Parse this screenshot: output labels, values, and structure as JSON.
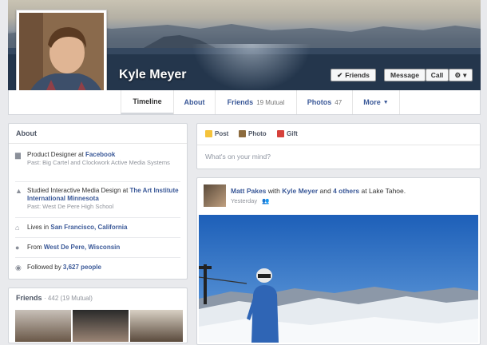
{
  "profile": {
    "name": "Kyle Meyer",
    "buttons": {
      "friends": "Friends",
      "message": "Message",
      "call": "Call"
    }
  },
  "nav": {
    "timeline": "Timeline",
    "about": "About",
    "friends": "Friends",
    "friends_count": "19 Mutual",
    "photos": "Photos",
    "photos_count": "47",
    "more": "More"
  },
  "about": {
    "title": "About",
    "work_prefix": "Product Designer at ",
    "work_company": "Facebook",
    "work_past": "Past: Big Cartel and Clockwork Active Media Systems",
    "edu_prefix": "Studied Interactive Media Design at ",
    "edu_school": "The Art Institute International Minnesota",
    "edu_past": "Past: West De Pere High School",
    "lives_prefix": "Lives in ",
    "lives_place": "San Francisco, California",
    "from_prefix": "From ",
    "from_place": "West De Pere, Wisconsin",
    "followed_prefix": "Followed by ",
    "followed_count": "3,627 people"
  },
  "friends_box": {
    "title": "Friends",
    "count": "· 442 (19 Mutual)"
  },
  "composer": {
    "post": "Post",
    "photo": "Photo",
    "gift": "Gift",
    "placeholder": "What's on your mind?"
  },
  "story": {
    "author": "Matt Pakes",
    "with_text": " with ",
    "tagged": "Kyle Meyer",
    "and_text": " and ",
    "others": "4 others",
    "at_text": " at Lake Tahoe.",
    "time": "Yesterday"
  },
  "icons": {
    "check": "check-icon",
    "gear": "gear-icon",
    "caret": "caret-down-icon",
    "briefcase": "briefcase-icon",
    "graduation": "graduation-cap-icon",
    "home": "home-icon",
    "pin": "location-pin-icon",
    "rss": "followers-icon",
    "post": "post-icon",
    "photo": "photo-icon",
    "gift": "gift-icon",
    "friends_privacy": "friends-privacy-icon"
  },
  "colors": {
    "link": "#3b5998",
    "page_bg": "#e9eaed"
  }
}
